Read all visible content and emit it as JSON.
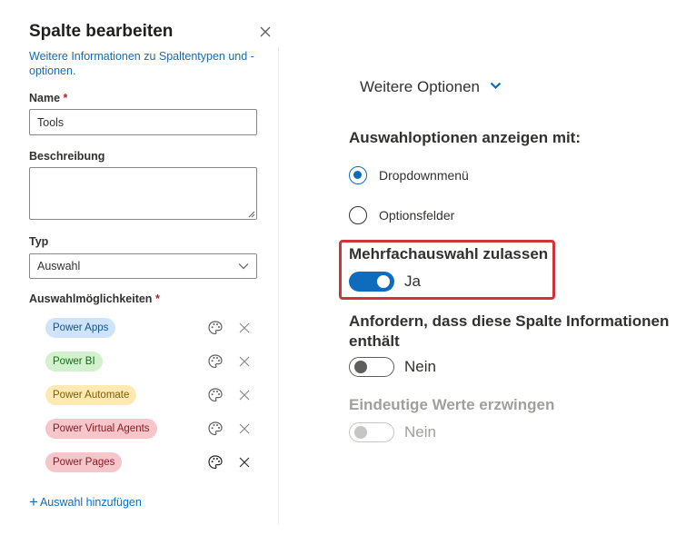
{
  "panel": {
    "title": "Spalte bearbeiten",
    "info_link": "Weitere Informationen zu Spaltentypen und -optionen.",
    "name_label": "Name",
    "required_mark": "*",
    "name_value": "Tools",
    "description_label": "Beschreibung",
    "description_value": "",
    "type_label": "Typ",
    "type_value": "Auswahl",
    "choices_label": "Auswahlmöglichkeiten",
    "choices": [
      {
        "label": "Power Apps",
        "bg": "#cfe4fa",
        "fg": "#0f548c"
      },
      {
        "label": "Power BI",
        "bg": "#d3f0cf",
        "fg": "#0e700e"
      },
      {
        "label": "Power Automate",
        "bg": "#fdeab3",
        "fg": "#835b00"
      },
      {
        "label": "Power Virtual Agents",
        "bg": "#f6c6cb",
        "fg": "#8a1a26"
      },
      {
        "label": "Power Pages",
        "bg": "#f6c6cb",
        "fg": "#8a1a26"
      }
    ],
    "add_choice": "Auswahl hinzufügen"
  },
  "options": {
    "more_options": "Weitere Optionen",
    "display_choices_title": "Auswahloptionen anzeigen mit:",
    "radio_dropdown": "Dropdownmenü",
    "radio_options": "Optionsfelder",
    "selected_display": "Dropdownmenü",
    "multi_select_title": "Mehrfachauswahl zulassen",
    "multi_select_value": "Ja",
    "require_title": "Anfordern, dass diese Spalte Informationen enthält",
    "require_value": "Nein",
    "unique_title": "Eindeutige Werte erzwingen",
    "unique_value": "Nein"
  },
  "colors": {
    "accent": "#0f6cbd",
    "highlight": "#d13438",
    "disabled": "#a19f9d"
  },
  "icons": {
    "close": "close-icon",
    "palette": "palette-icon",
    "remove": "remove-icon",
    "chevron": "chevron-down-icon",
    "add": "add-icon"
  }
}
